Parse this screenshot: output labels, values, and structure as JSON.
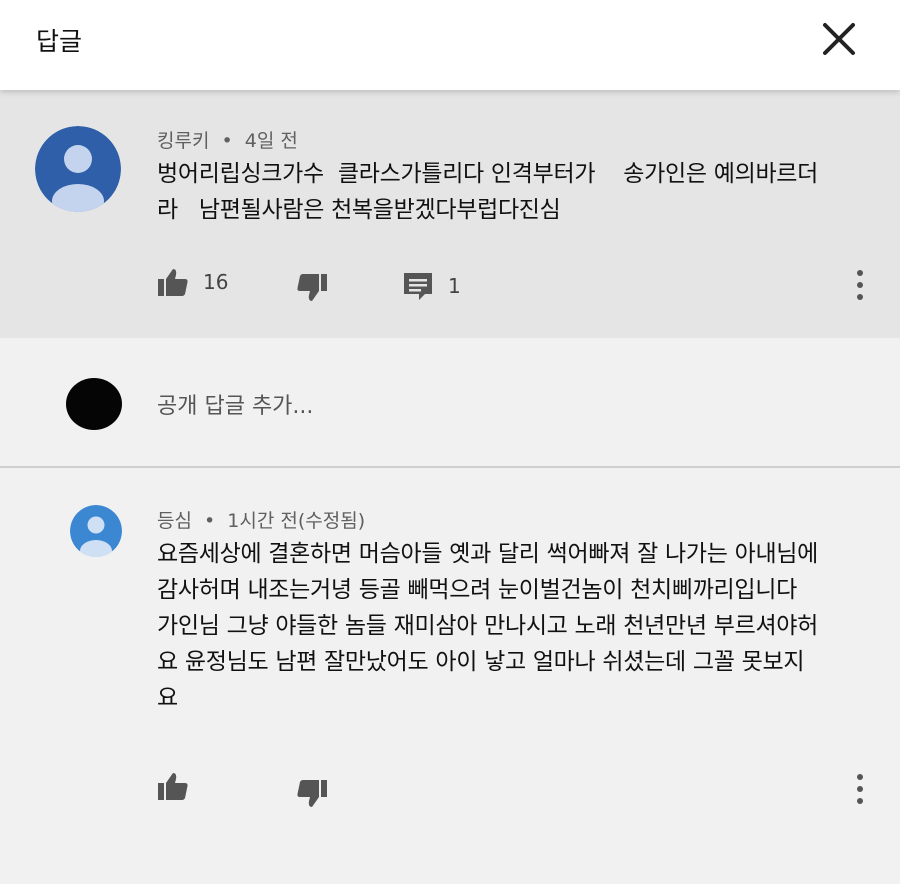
{
  "header": {
    "title": "답글",
    "close_icon": "close-icon"
  },
  "main_comment": {
    "author": "킹루키",
    "separator": "•",
    "time": "4일 전",
    "text": "벙어리립싱크가수  클라스가틀리다 인격부터가    송가인은 예의바르더\n라   남편될사람은 천복을받겠다부럽다진심",
    "like_count": "16",
    "reply_count": "1",
    "avatar_color": "#2e5fa8"
  },
  "reply_input": {
    "placeholder": "공개 답글 추가..."
  },
  "reply": {
    "author": "등심",
    "separator": "•",
    "time": "1시간 전(수정됨)",
    "text": "요즘세상에 결혼하면 머슴아들 옛과 달리 썩어빠져 잘 나가는 아내님에\n감사허며 내조는거녕 등골 빼먹으려 눈이벌건놈이 천치삐까리입니다\n가인님 그냥 야들한 놈들 재미삼아 만나시고 노래 천년만년 부르셔야허\n요 윤정님도 남편 잘만났어도 아이 낳고 얼마나 쉬셨는데 그꼴 못보지\n요",
    "avatar_color": "#3b87d2"
  }
}
